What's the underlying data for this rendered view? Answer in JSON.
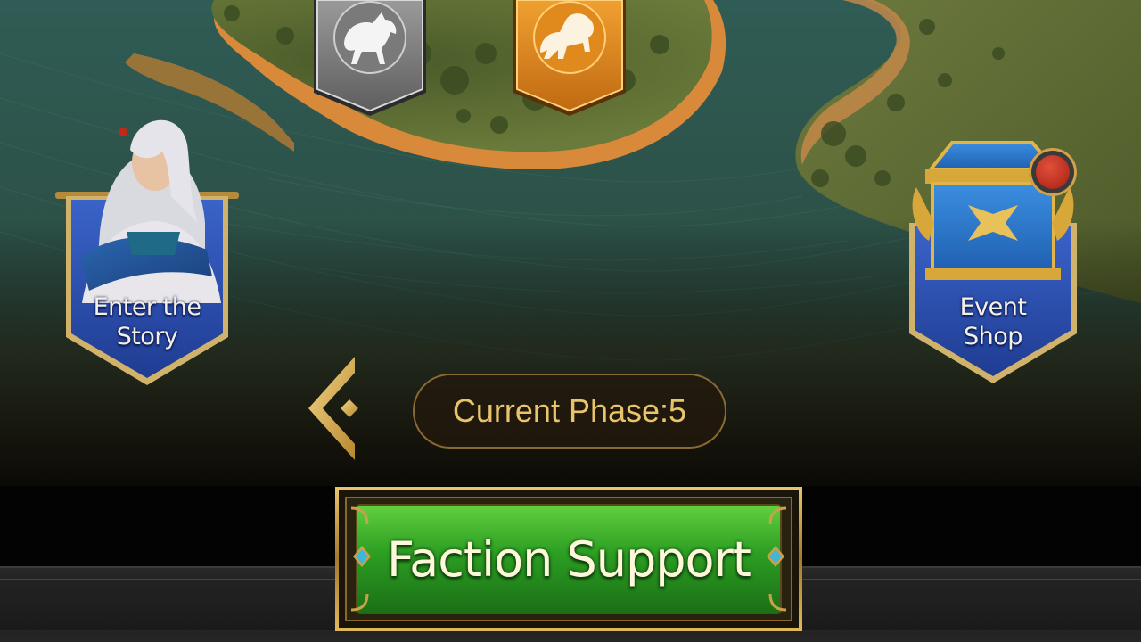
{
  "left_banner": {
    "label": "Enter the\nStory",
    "icon": "hero-portrait-icon"
  },
  "right_banner": {
    "label": "Event\nShop",
    "icon": "treasure-chest-icon"
  },
  "phase": {
    "label": "Current Phase",
    "separator": ":",
    "value": "5"
  },
  "primary_action": {
    "label": "Faction Support"
  },
  "factions": [
    {
      "emblem": "horse-icon",
      "color": "#8c8c8c"
    },
    {
      "emblem": "lion-icon",
      "color": "#e08a1e"
    }
  ],
  "notification": {
    "color": "#c0291a"
  },
  "colors": {
    "river": "#2e5a52",
    "land": "#5c6b3a",
    "shore": "#d98a3a",
    "gold": "#c9a14a",
    "button_green": "#2ea12a",
    "banner_blue": "#2b4fae"
  }
}
